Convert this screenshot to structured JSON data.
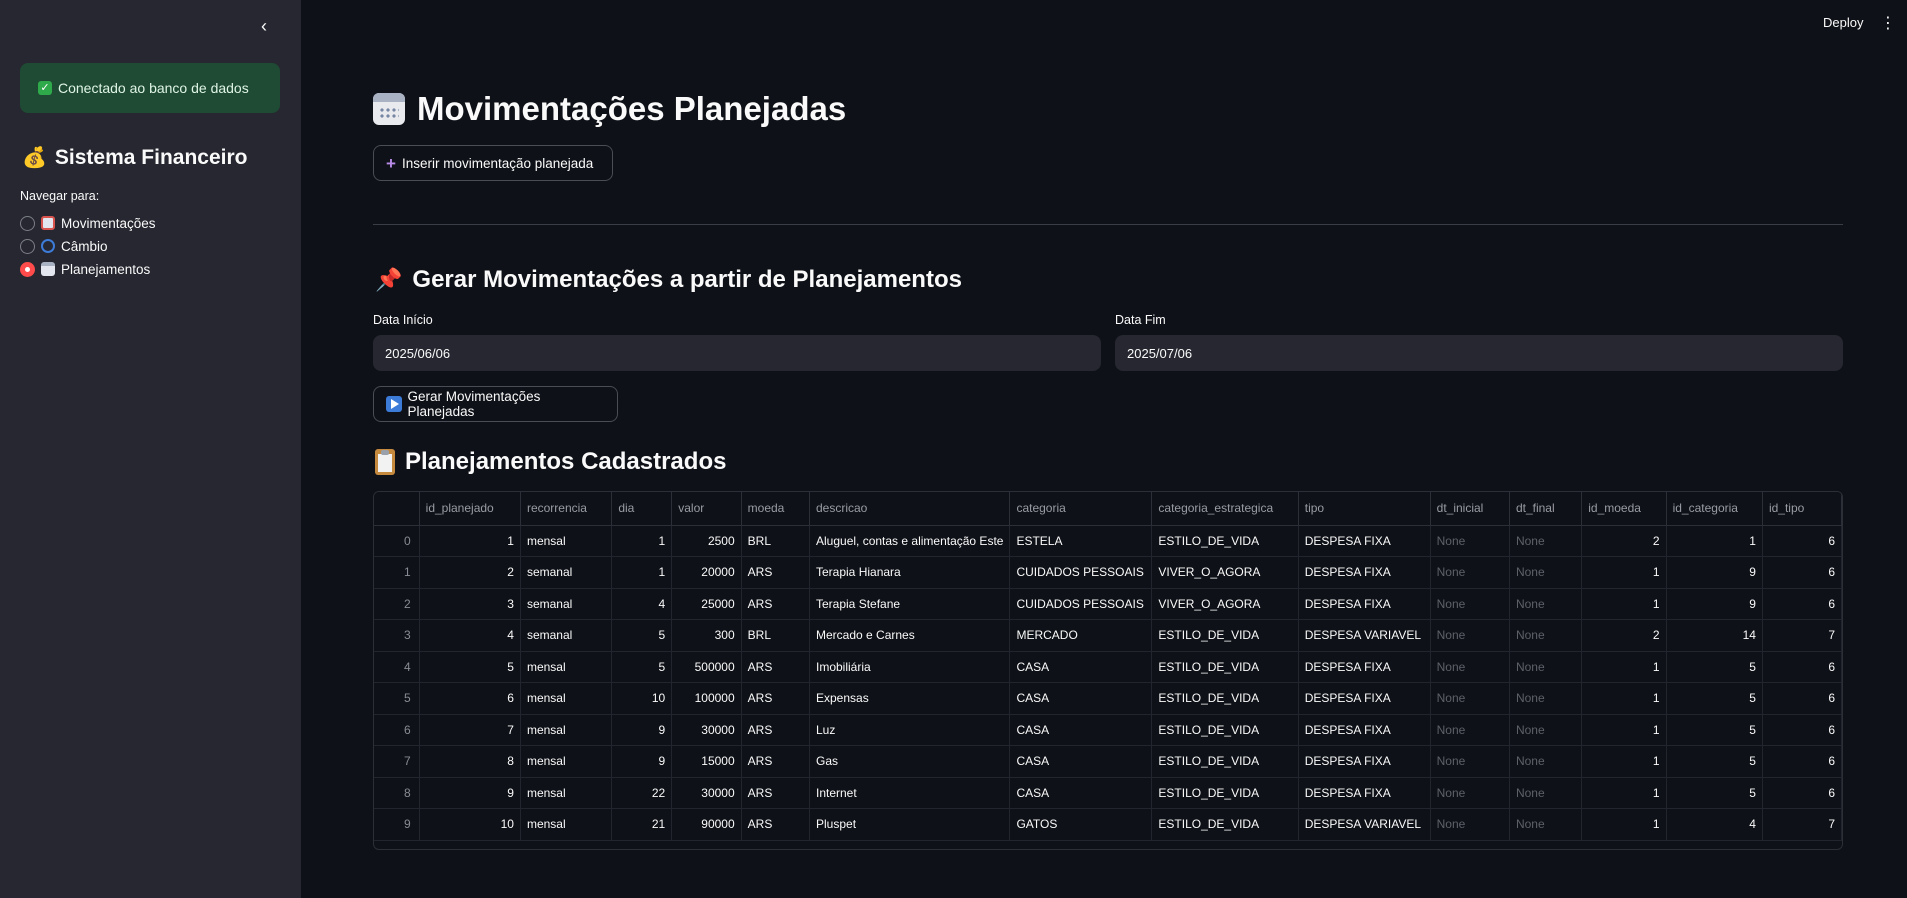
{
  "header": {
    "deploy_label": "Deploy",
    "menu_icon": "⋮"
  },
  "sidebar": {
    "collapse_icon": "‹",
    "alert_text": "Conectado ao banco de dados",
    "title_emoji": "💰",
    "title": "Sistema Financeiro",
    "nav_label": "Navegar para:",
    "items": [
      {
        "label": "Movimentações",
        "icon": "notebook-icon",
        "selected": false
      },
      {
        "label": "Câmbio",
        "icon": "exchange-icon",
        "selected": false
      },
      {
        "label": "Planejamentos",
        "icon": "calendar-icon",
        "selected": true
      }
    ]
  },
  "main": {
    "title": "Movimentações Planejadas",
    "insert_button": "Inserir movimentação planejada",
    "generate_section": {
      "title": "Gerar Movimentações a partir de Planejamentos",
      "start_label": "Data Início",
      "start_value": "2025/06/06",
      "end_label": "Data Fim",
      "end_value": "2025/07/06",
      "button": "Gerar Movimentações Planejadas"
    },
    "list_section": {
      "title": "Planejamentos Cadastrados"
    }
  },
  "table": {
    "columns": [
      "",
      "id_planejado",
      "recorrencia",
      "dia",
      "valor",
      "moeda",
      "descricao",
      "categoria",
      "categoria_estrategica",
      "tipo",
      "dt_inicial",
      "dt_final",
      "id_moeda",
      "id_categoria",
      "id_tipo"
    ],
    "rows": [
      [
        "0",
        "1",
        "mensal",
        "1",
        "2500",
        "BRL",
        "Aluguel, contas e alimentação Este",
        "ESTELA",
        "ESTILO_DE_VIDA",
        "DESPESA FIXA",
        "None",
        "None",
        "2",
        "1",
        "6"
      ],
      [
        "1",
        "2",
        "semanal",
        "1",
        "20000",
        "ARS",
        "Terapia Hianara",
        "CUIDADOS PESSOAIS",
        "VIVER_O_AGORA",
        "DESPESA FIXA",
        "None",
        "None",
        "1",
        "9",
        "6"
      ],
      [
        "2",
        "3",
        "semanal",
        "4",
        "25000",
        "ARS",
        "Terapia Stefane",
        "CUIDADOS PESSOAIS",
        "VIVER_O_AGORA",
        "DESPESA FIXA",
        "None",
        "None",
        "1",
        "9",
        "6"
      ],
      [
        "3",
        "4",
        "semanal",
        "5",
        "300",
        "BRL",
        "Mercado e Carnes",
        "MERCADO",
        "ESTILO_DE_VIDA",
        "DESPESA VARIAVEL",
        "None",
        "None",
        "2",
        "14",
        "7"
      ],
      [
        "4",
        "5",
        "mensal",
        "5",
        "500000",
        "ARS",
        "Imobiliária",
        "CASA",
        "ESTILO_DE_VIDA",
        "DESPESA FIXA",
        "None",
        "None",
        "1",
        "5",
        "6"
      ],
      [
        "5",
        "6",
        "mensal",
        "10",
        "100000",
        "ARS",
        "Expensas",
        "CASA",
        "ESTILO_DE_VIDA",
        "DESPESA FIXA",
        "None",
        "None",
        "1",
        "5",
        "6"
      ],
      [
        "6",
        "7",
        "mensal",
        "9",
        "30000",
        "ARS",
        "Luz",
        "CASA",
        "ESTILO_DE_VIDA",
        "DESPESA FIXA",
        "None",
        "None",
        "1",
        "5",
        "6"
      ],
      [
        "7",
        "8",
        "mensal",
        "9",
        "15000",
        "ARS",
        "Gas",
        "CASA",
        "ESTILO_DE_VIDA",
        "DESPESA FIXA",
        "None",
        "None",
        "1",
        "5",
        "6"
      ],
      [
        "8",
        "9",
        "mensal",
        "22",
        "30000",
        "ARS",
        "Internet",
        "CASA",
        "ESTILO_DE_VIDA",
        "DESPESA FIXA",
        "None",
        "None",
        "1",
        "5",
        "6"
      ],
      [
        "9",
        "10",
        "mensal",
        "21",
        "90000",
        "ARS",
        "Pluspet",
        "GATOS",
        "ESTILO_DE_VIDA",
        "DESPESA VARIAVEL",
        "None",
        "None",
        "1",
        "4",
        "7"
      ]
    ]
  }
}
